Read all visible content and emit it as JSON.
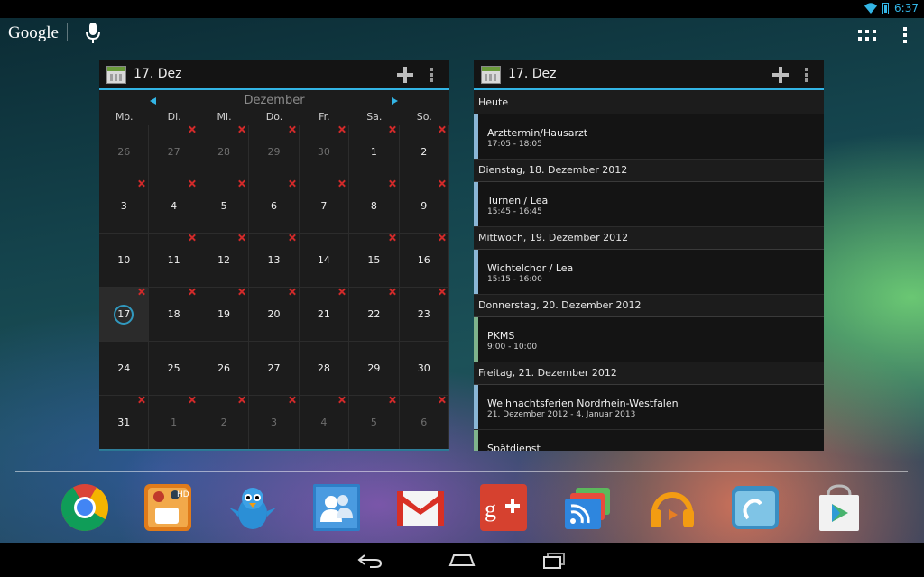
{
  "status_bar": {
    "time": "6:37"
  },
  "search_bar": {
    "logo": "Google"
  },
  "month_widget": {
    "date": "17. Dez",
    "month_name": "Dezember",
    "weekdays": [
      "Mo.",
      "Di.",
      "Mi.",
      "Do.",
      "Fr.",
      "Sa.",
      "So."
    ],
    "days": [
      {
        "n": "26",
        "other": true,
        "mark": false
      },
      {
        "n": "27",
        "other": true,
        "mark": true
      },
      {
        "n": "28",
        "other": true,
        "mark": true
      },
      {
        "n": "29",
        "other": true,
        "mark": true
      },
      {
        "n": "30",
        "other": true,
        "mark": true
      },
      {
        "n": "1",
        "other": false,
        "mark": true
      },
      {
        "n": "2",
        "other": false,
        "mark": true
      },
      {
        "n": "3",
        "other": false,
        "mark": true
      },
      {
        "n": "4",
        "other": false,
        "mark": true
      },
      {
        "n": "5",
        "other": false,
        "mark": true
      },
      {
        "n": "6",
        "other": false,
        "mark": true
      },
      {
        "n": "7",
        "other": false,
        "mark": true
      },
      {
        "n": "8",
        "other": false,
        "mark": true
      },
      {
        "n": "9",
        "other": false,
        "mark": true
      },
      {
        "n": "10",
        "other": false,
        "mark": false
      },
      {
        "n": "11",
        "other": false,
        "mark": true
      },
      {
        "n": "12",
        "other": false,
        "mark": true
      },
      {
        "n": "13",
        "other": false,
        "mark": true
      },
      {
        "n": "14",
        "other": false,
        "mark": false
      },
      {
        "n": "15",
        "other": false,
        "mark": true
      },
      {
        "n": "16",
        "other": false,
        "mark": true
      },
      {
        "n": "17",
        "other": false,
        "mark": true,
        "today": true
      },
      {
        "n": "18",
        "other": false,
        "mark": true
      },
      {
        "n": "19",
        "other": false,
        "mark": true
      },
      {
        "n": "20",
        "other": false,
        "mark": true
      },
      {
        "n": "21",
        "other": false,
        "mark": true
      },
      {
        "n": "22",
        "other": false,
        "mark": true
      },
      {
        "n": "23",
        "other": false,
        "mark": true
      },
      {
        "n": "24",
        "other": false,
        "mark": false
      },
      {
        "n": "25",
        "other": false,
        "mark": false
      },
      {
        "n": "26",
        "other": false,
        "mark": false
      },
      {
        "n": "27",
        "other": false,
        "mark": false
      },
      {
        "n": "28",
        "other": false,
        "mark": false
      },
      {
        "n": "29",
        "other": false,
        "mark": false
      },
      {
        "n": "30",
        "other": false,
        "mark": false
      },
      {
        "n": "31",
        "other": false,
        "mark": true
      },
      {
        "n": "1",
        "other": true,
        "mark": true
      },
      {
        "n": "2",
        "other": true,
        "mark": true
      },
      {
        "n": "3",
        "other": true,
        "mark": true
      },
      {
        "n": "4",
        "other": true,
        "mark": true
      },
      {
        "n": "5",
        "other": true,
        "mark": true
      },
      {
        "n": "6",
        "other": true,
        "mark": true
      }
    ]
  },
  "agenda_widget": {
    "date": "17. Dez",
    "groups": [
      {
        "header": "Heute",
        "events": [
          {
            "title": "Arzttermin/Hausarzt",
            "time": "17:05 - 18:05",
            "color": "blue"
          }
        ]
      },
      {
        "header": "Dienstag, 18. Dezember 2012",
        "events": [
          {
            "title": "Turnen / Lea",
            "time": "15:45 - 16:45",
            "color": "blue"
          }
        ]
      },
      {
        "header": "Mittwoch, 19. Dezember 2012",
        "events": [
          {
            "title": "Wichtelchor / Lea",
            "time": "15:15 - 16:00",
            "color": "blue"
          }
        ]
      },
      {
        "header": "Donnerstag, 20. Dezember 2012",
        "events": [
          {
            "title": "PKMS",
            "time": "9:00 - 10:00",
            "color": "green"
          }
        ]
      },
      {
        "header": "Freitag, 21. Dezember 2012",
        "events": [
          {
            "title": "Weihnachtsferien Nordrhein-Westfalen",
            "time": "21. Dezember 2012 - 4. Januar 2013",
            "color": "blue"
          },
          {
            "title": "Spätdienst",
            "time": "",
            "color": "green"
          }
        ]
      }
    ]
  },
  "dock": {
    "apps": [
      "chrome-icon",
      "games-app-icon",
      "tweetcaster-icon",
      "contacts-icon",
      "gmail-icon",
      "google-plus-icon",
      "rss-reader-icon",
      "play-music-icon",
      "file-manager-icon",
      "play-store-icon"
    ]
  },
  "colors": {
    "accent": "#33b5e5",
    "mark": "#d12a2a",
    "event_blue": "#8ab6d6",
    "event_green": "#7fb38c"
  }
}
